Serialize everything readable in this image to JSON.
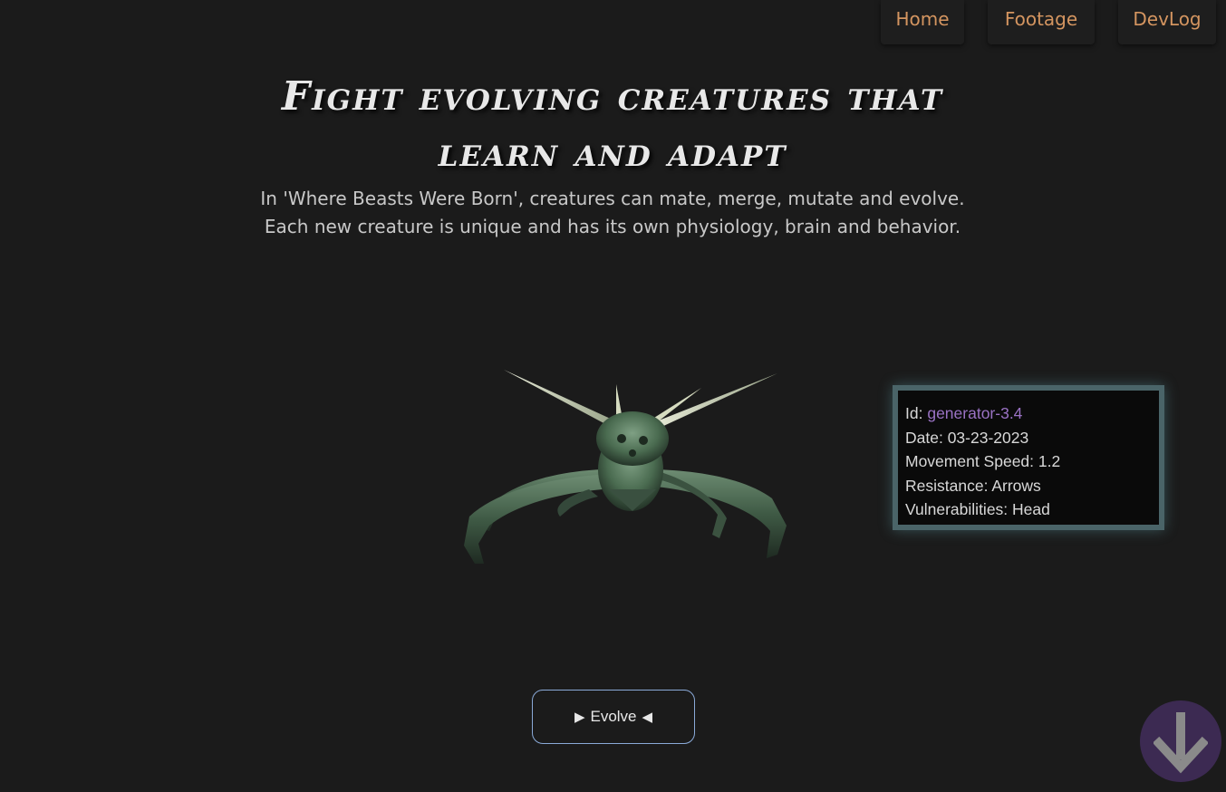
{
  "nav": {
    "items": [
      {
        "label": "Home"
      },
      {
        "label": "Footage"
      },
      {
        "label": "DevLog"
      }
    ]
  },
  "hero": {
    "title_line1": "Fight evolving creatures that",
    "title_line2": "learn and adapt",
    "subtitle_line1": "In 'Where Beasts Were Born', creatures can mate, merge, mutate and evolve.",
    "subtitle_line2": "Each new creature is unique and has its own physiology, brain and behavior."
  },
  "creature_card": {
    "id_label": "Id:",
    "id_value": "generator-3.4",
    "date_label": "Date:",
    "date_value": "03-23-2023",
    "speed_label": "Movement Speed:",
    "speed_value": "1.2",
    "resistance_label": "Resistance:",
    "resistance_value": "Arrows",
    "vulnerabilities_label": "Vulnerabilities:",
    "vulnerabilities_value": "Head"
  },
  "evolve": {
    "label": "Evolve",
    "left_glyph": "▶",
    "right_glyph": "◀"
  },
  "icons": {
    "scroll": "arrow-down-icon",
    "creature": "creature-render"
  },
  "colors": {
    "background": "#1b1b1b",
    "nav_text": "#d49560",
    "id_value": "#9a72c4",
    "card_border": "#4a6468",
    "button_border": "#8aaad8",
    "scroll_button": "#3c2a52"
  }
}
